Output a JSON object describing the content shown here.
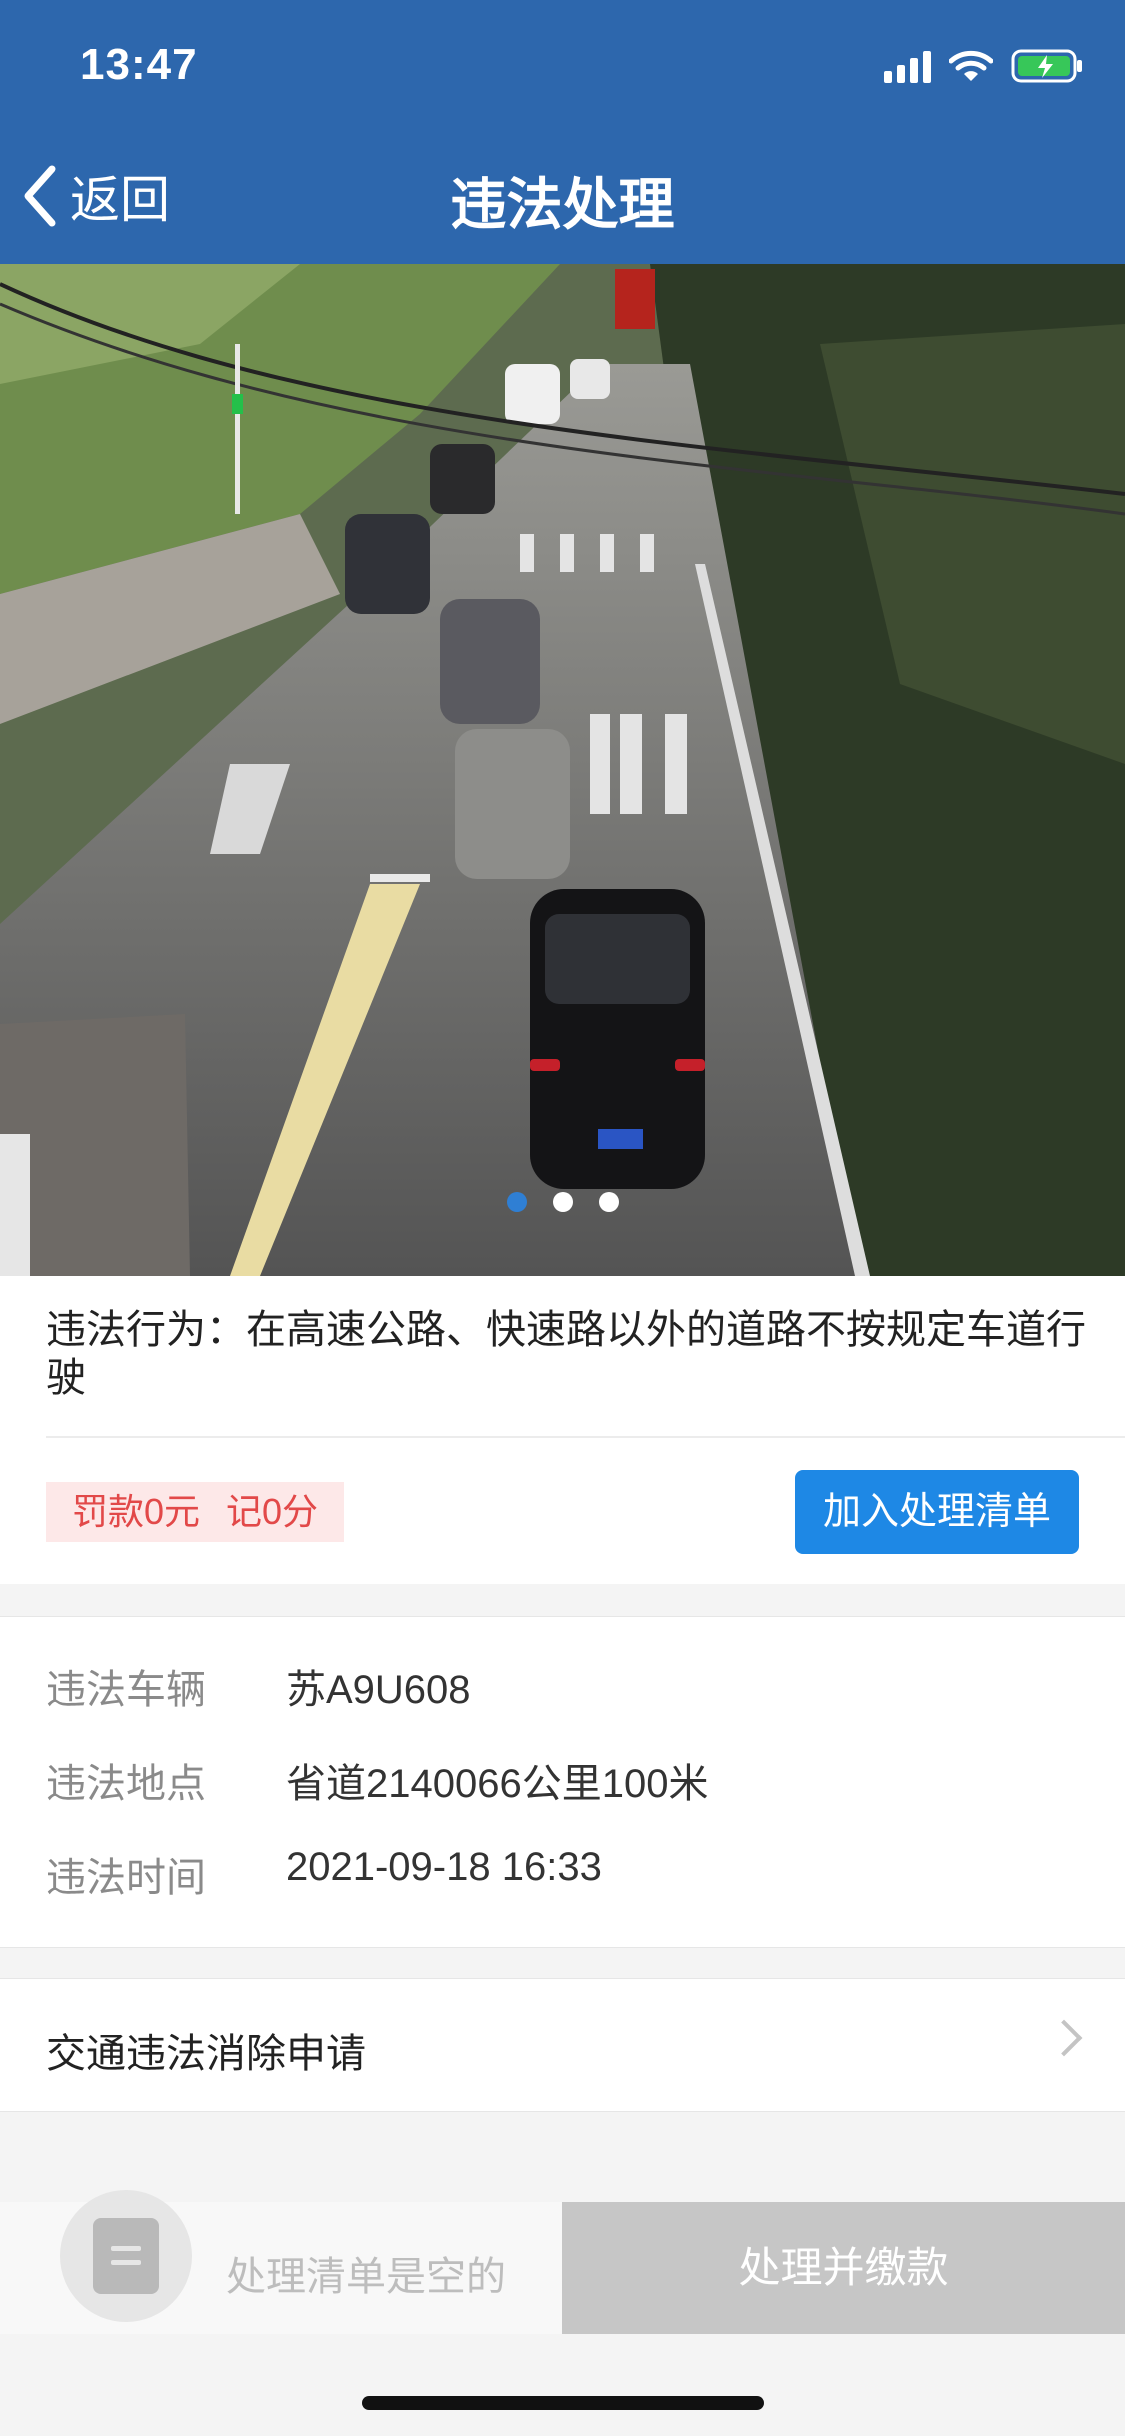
{
  "status_bar": {
    "time": "13:47"
  },
  "nav": {
    "back_label": "返回",
    "title": "违法处理"
  },
  "carousel": {
    "total": 3,
    "active_index": 0
  },
  "violation": {
    "behavior": "违法行为：在高速公路、快速路以外的道路不按规定车道行驶",
    "fine": "罚款0元",
    "points": "记0分",
    "add_button": "加入处理清单"
  },
  "details": [
    {
      "label": "违法车辆",
      "value": "苏A9U608"
    },
    {
      "label": "违法地点",
      "value": "省道2140066公里100米"
    },
    {
      "label": "违法时间",
      "value": "2021-09-18 16:33"
    }
  ],
  "appeal": {
    "label": "交通违法消除申请"
  },
  "bottom": {
    "empty_text": "处理清单是空的",
    "pay_button": "处理并缴款"
  },
  "colors": {
    "header": "#2d67ad",
    "primary_button": "#1e88e5",
    "fine_text": "#e24949",
    "fine_bg": "#fde8e8",
    "disabled_button": "#c6c6c6"
  }
}
